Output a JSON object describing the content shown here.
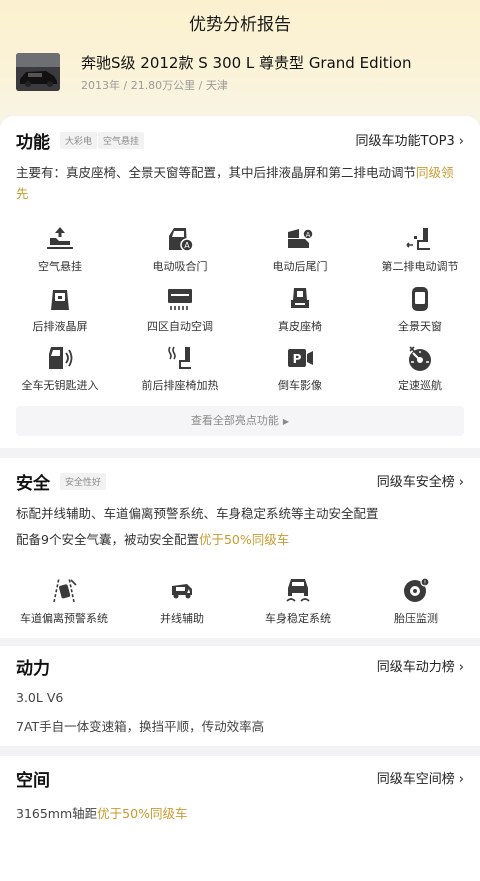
{
  "header": {
    "title": "优势分析报告",
    "car_name": "奔驰S级 2012款 S 300 L 尊贵型 Grand Edition",
    "car_meta": "2013年 / 21.80万公里 / 天津"
  },
  "features": {
    "title": "功能",
    "tags": [
      "大彩电",
      "空气悬挂"
    ],
    "link": "同级车功能TOP3",
    "summary_prefix": "主要有：真皮座椅、全景天窗等配置，其中后排液晶屏和第二排电动调节",
    "summary_highlight": "同级领先",
    "items": [
      {
        "label": "空气悬挂",
        "icon": "air-suspension-icon"
      },
      {
        "label": "电动吸合门",
        "icon": "soft-close-door-icon"
      },
      {
        "label": "电动后尾门",
        "icon": "power-tailgate-icon"
      },
      {
        "label": "第二排电动调节",
        "icon": "second-row-seat-icon"
      },
      {
        "label": "后排液晶屏",
        "icon": "rear-screen-icon"
      },
      {
        "label": "四区自动空调",
        "icon": "four-zone-ac-icon"
      },
      {
        "label": "真皮座椅",
        "icon": "leather-seat-icon"
      },
      {
        "label": "全景天窗",
        "icon": "panoramic-sunroof-icon"
      },
      {
        "label": "全车无钥匙进入",
        "icon": "keyless-entry-icon"
      },
      {
        "label": "前后排座椅加热",
        "icon": "seat-heating-icon"
      },
      {
        "label": "倒车影像",
        "icon": "reverse-camera-icon"
      },
      {
        "label": "定速巡航",
        "icon": "cruise-control-icon"
      }
    ],
    "view_all": "查看全部亮点功能"
  },
  "safety": {
    "title": "安全",
    "tag": "安全性好",
    "link": "同级车安全榜",
    "line1": "标配并线辅助、车道偏离预警系统、车身稳定系统等主动安全配置",
    "line2_prefix": "配备9个安全气囊，被动安全配置",
    "line2_highlight": "优于50%同级车",
    "items": [
      {
        "label": "车道偏离预警系统",
        "icon": "lane-departure-icon"
      },
      {
        "label": "并线辅助",
        "icon": "blind-spot-icon"
      },
      {
        "label": "车身稳定系统",
        "icon": "stability-control-icon"
      },
      {
        "label": "胎压监测",
        "icon": "tire-pressure-icon"
      }
    ]
  },
  "power": {
    "title": "动力",
    "link": "同级车动力榜",
    "engine": "3.0L V6",
    "transmission": "7AT手自一体变速箱，换挡平顺，传动效率高"
  },
  "space": {
    "title": "空间",
    "link": "同级车空间榜",
    "wheelbase_prefix": "3165mm轴距",
    "wheelbase_highlight": "优于50%同级车"
  },
  "colors": {
    "accent": "#c99a2e",
    "hero": "#fbf1cf",
    "icon": "#3a3a3a"
  }
}
